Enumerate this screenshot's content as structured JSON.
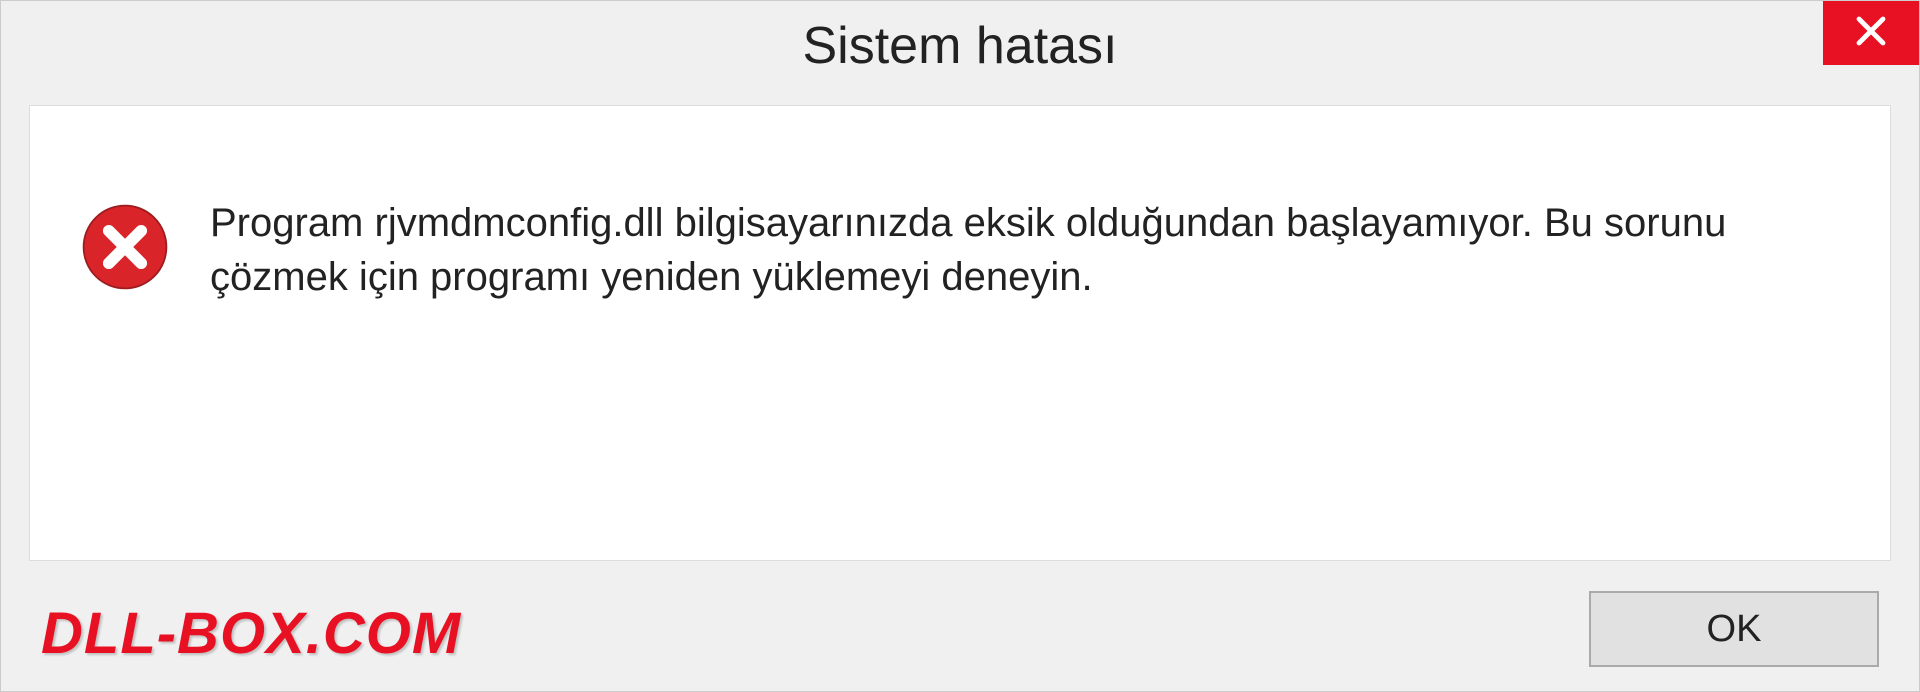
{
  "title_bar": {
    "title": "Sistem hatası"
  },
  "content": {
    "message": "Program rjvmdmconfig.dll bilgisayarınızda eksik olduğundan başlayamıyor. Bu sorunu çözmek için programı yeniden yüklemeyi deneyin."
  },
  "footer": {
    "logo_text": "DLL-BOX.COM",
    "ok_label": "OK"
  }
}
